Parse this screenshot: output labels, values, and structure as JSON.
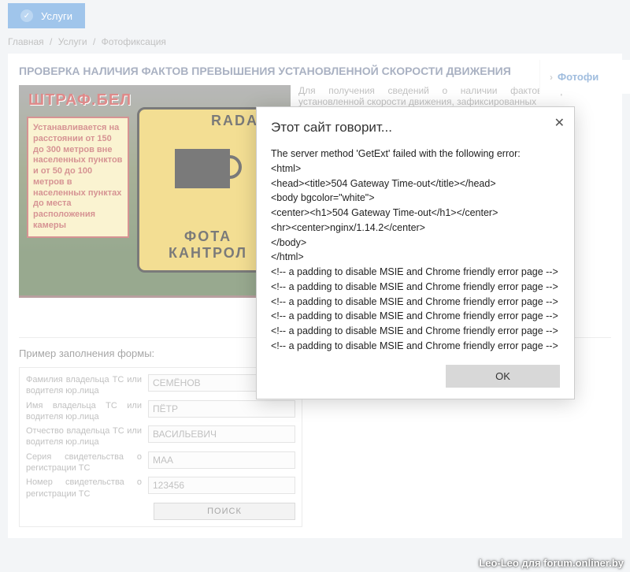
{
  "tab": {
    "label": "Услуги"
  },
  "breadcrumb": {
    "items": [
      "Главная",
      "Услуги",
      "Фотофиксация"
    ]
  },
  "page": {
    "title": "ПРОВЕРКА НАЛИЧИЯ ФАКТОВ ПРЕВЫШЕНИЯ УСТАНОВЛЕННОЙ СКОРОСТИ ДВИЖЕНИЯ",
    "intro": "Для получения сведений о наличии фактов превышения установленной скорости движения, зафиксированных"
  },
  "banner": {
    "title": "ШТРАФ.БЕЛ",
    "note": "Устанавливается на расстоянии от 150 до 300 метров вне населенных пунктов и от 50 до 100 метров в населенных пунктах до места расположения камеры",
    "sign_top": "RADAR",
    "sign_line1": "ФОТА",
    "sign_line2": "КАНТРОЛ"
  },
  "form": {
    "caption": "Пример заполнения формы:",
    "rows": [
      {
        "label": "Фамилия владельца ТС или водителя юр.лица",
        "value": "СЕМЁНОВ"
      },
      {
        "label": "Имя владельца ТС или водителя юр.лица",
        "value": "ПЁТР"
      },
      {
        "label": "Отчество владельца ТС или водителя юр.лица",
        "value": "ВАСИЛЬЕВИЧ"
      },
      {
        "label": "Серия свидетельства о регистрации ТС",
        "value": "МАА"
      },
      {
        "label": "Номер свидетельства о регистрации ТС",
        "value": "123456"
      }
    ],
    "search": "ПОИСК"
  },
  "sidebar": {
    "item": "Фотофи"
  },
  "dialog": {
    "title": "Этот сайт говорит...",
    "body": "The server method 'GetExt' failed with the following error:\n<html>\n<head><title>504 Gateway Time-out</title></head>\n<body bgcolor=\"white\">\n<center><h1>504 Gateway Time-out</h1></center>\n<hr><center>nginx/1.14.2</center>\n</body>\n</html>\n<!-- a padding to disable MSIE and Chrome friendly error page -->\n<!-- a padding to disable MSIE and Chrome friendly error page -->\n<!-- a padding to disable MSIE and Chrome friendly error page -->\n<!-- a padding to disable MSIE and Chrome friendly error page -->\n<!-- a padding to disable MSIE and Chrome friendly error page -->\n<!-- a padding to disable MSIE and Chrome friendly error page -->",
    "ok": "OK"
  },
  "watermark": "Leo-Leo для forum.onliner.by"
}
